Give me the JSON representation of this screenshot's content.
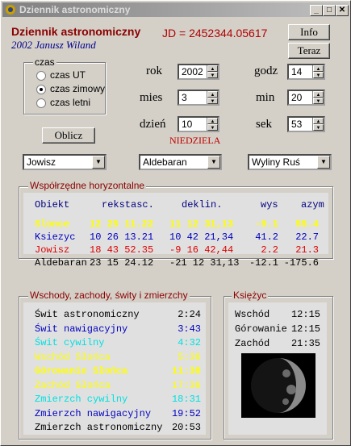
{
  "window": {
    "title": "Dziennik astronomiczny"
  },
  "header": {
    "app_name": "Dziennik astronomiczny",
    "author": "2002 Janusz Wiland",
    "jd_label": "JD = ",
    "jd_value": "2452344.05617"
  },
  "buttons": {
    "info": "Info",
    "teraz": "Teraz",
    "oblicz": "Oblicz"
  },
  "czas": {
    "label": "czas",
    "options": [
      "czas UT",
      "czas zimowy",
      "czas letni"
    ],
    "selected": 1
  },
  "date": {
    "rok_label": "rok",
    "rok": "2002",
    "mies_label": "mies",
    "mies": "3",
    "dzien_label": "dzień",
    "dzien": "10"
  },
  "time": {
    "godz_label": "godz",
    "godz": "14",
    "min_label": "min",
    "min": "20",
    "sek_label": "sek",
    "sek": "53"
  },
  "weekday": "NIEDZIELA",
  "selects": {
    "planet": "Jowisz",
    "star": "Aldebaran",
    "location": "Wyliny Ruś"
  },
  "horizontal": {
    "label": "Współrzędne horyzontalne",
    "headers": {
      "obiekt": "Obiekt",
      "rekstasc": "rekstasc.",
      "deklin": "deklin.",
      "wys": "wys",
      "azym": "azym"
    },
    "rows": [
      {
        "name": "Slonce",
        "ra": "12 25 11.22",
        "dec": "11 12 31,13",
        "alt": "-9.1",
        "az": "55.4",
        "color": "#ffff00"
      },
      {
        "name": "Ksiezyc",
        "ra": "10 26 13.21",
        "dec": "10 42 21,34",
        "alt": "41.2",
        "az": "22.7",
        "color": "#0000c0"
      },
      {
        "name": "Jowisz",
        "ra": "18 43 52.35",
        "dec": "-9 16 42,44",
        "alt": "2.2",
        "az": "21.3",
        "color": "#e00000"
      },
      {
        "name": "Aldebaran",
        "ra": "23 15 24.12",
        "dec": "-21 12 31,13",
        "alt": "-12.1",
        "az": "-175.6",
        "color": "#000000"
      }
    ]
  },
  "twilight": {
    "label": "Wschody, zachody, świty i zmierzchy",
    "rows": [
      {
        "name": "Świt astronomiczny",
        "time": "2:24",
        "color": "#000000"
      },
      {
        "name": "Świt nawigacyjny",
        "time": "3:43",
        "color": "#0000c0"
      },
      {
        "name": "Świt cywilny",
        "time": "4:32",
        "color": "#00e0e0"
      },
      {
        "name": "Wschód Słońca",
        "time": "5:36",
        "color": "#ffff00"
      },
      {
        "name": "Górowanie Słońca",
        "time": "11:38",
        "color": "#ffff00"
      },
      {
        "name": "Zachód Słońca",
        "time": "17:36",
        "color": "#ffff00"
      },
      {
        "name": "Zmierzch cywilny",
        "time": "18:31",
        "color": "#00e0e0"
      },
      {
        "name": "Zmierzch nawigacyjny",
        "time": "19:52",
        "color": "#0000c0"
      },
      {
        "name": "Zmierzch astronomiczny",
        "time": "20:53",
        "color": "#000000"
      }
    ]
  },
  "moon": {
    "label": "Księżyc",
    "rows": [
      {
        "name": "Wschód",
        "time": "12:15"
      },
      {
        "name": "Górowanie",
        "time": "12:15"
      },
      {
        "name": "Zachód",
        "time": "21:35"
      }
    ]
  }
}
